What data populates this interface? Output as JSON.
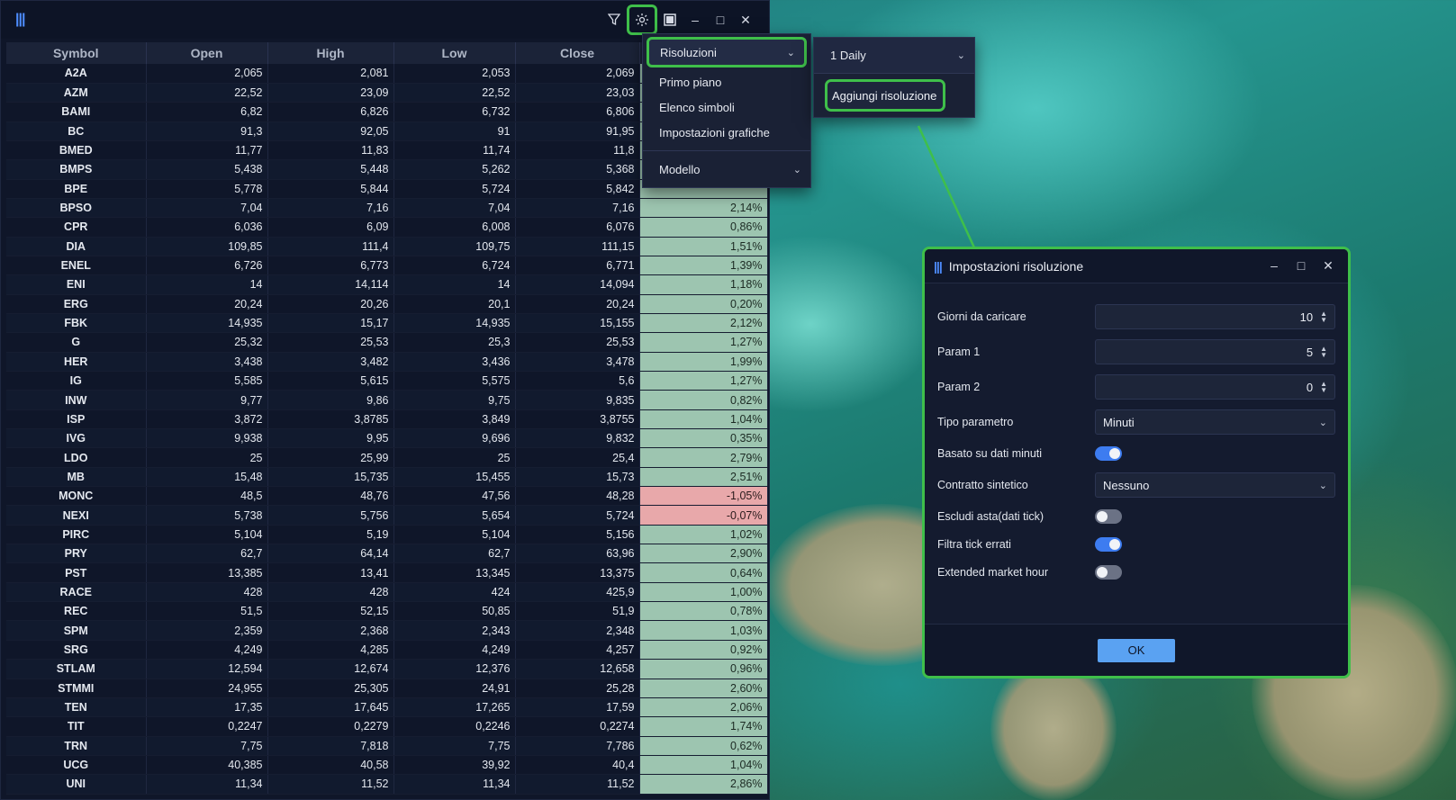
{
  "app": {
    "logo_glyph": "|||",
    "toolbar_icons": [
      "filter-icon",
      "gear-icon",
      "panel-icon",
      "minimize-icon",
      "maximize-icon",
      "close-icon"
    ]
  },
  "table": {
    "columns": [
      "Symbol",
      "Open",
      "High",
      "Low",
      "Close",
      ""
    ],
    "rows": [
      {
        "symbol": "A2A",
        "open": "2,065",
        "high": "2,081",
        "low": "2,053",
        "close": "2,069",
        "change": ""
      },
      {
        "symbol": "AZM",
        "open": "22,52",
        "high": "23,09",
        "low": "22,52",
        "close": "23,03",
        "change": ""
      },
      {
        "symbol": "BAMI",
        "open": "6,82",
        "high": "6,826",
        "low": "6,732",
        "close": "6,806",
        "change": ""
      },
      {
        "symbol": "BC",
        "open": "91,3",
        "high": "92,05",
        "low": "91",
        "close": "91,95",
        "change": ""
      },
      {
        "symbol": "BMED",
        "open": "11,77",
        "high": "11,83",
        "low": "11,74",
        "close": "11,8",
        "change": ""
      },
      {
        "symbol": "BMPS",
        "open": "5,438",
        "high": "5,448",
        "low": "5,262",
        "close": "5,368",
        "change": ""
      },
      {
        "symbol": "BPE",
        "open": "5,778",
        "high": "5,844",
        "low": "5,724",
        "close": "5,842",
        "change": ""
      },
      {
        "symbol": "BPSO",
        "open": "7,04",
        "high": "7,16",
        "low": "7,04",
        "close": "7,16",
        "change": "2,14%"
      },
      {
        "symbol": "CPR",
        "open": "6,036",
        "high": "6,09",
        "low": "6,008",
        "close": "6,076",
        "change": "0,86%"
      },
      {
        "symbol": "DIA",
        "open": "109,85",
        "high": "111,4",
        "low": "109,75",
        "close": "111,15",
        "change": "1,51%"
      },
      {
        "symbol": "ENEL",
        "open": "6,726",
        "high": "6,773",
        "low": "6,724",
        "close": "6,771",
        "change": "1,39%"
      },
      {
        "symbol": "ENI",
        "open": "14",
        "high": "14,114",
        "low": "14",
        "close": "14,094",
        "change": "1,18%"
      },
      {
        "symbol": "ERG",
        "open": "20,24",
        "high": "20,26",
        "low": "20,1",
        "close": "20,24",
        "change": "0,20%"
      },
      {
        "symbol": "FBK",
        "open": "14,935",
        "high": "15,17",
        "low": "14,935",
        "close": "15,155",
        "change": "2,12%"
      },
      {
        "symbol": "G",
        "open": "25,32",
        "high": "25,53",
        "low": "25,3",
        "close": "25,53",
        "change": "1,27%"
      },
      {
        "symbol": "HER",
        "open": "3,438",
        "high": "3,482",
        "low": "3,436",
        "close": "3,478",
        "change": "1,99%"
      },
      {
        "symbol": "IG",
        "open": "5,585",
        "high": "5,615",
        "low": "5,575",
        "close": "5,6",
        "change": "1,27%"
      },
      {
        "symbol": "INW",
        "open": "9,77",
        "high": "9,86",
        "low": "9,75",
        "close": "9,835",
        "change": "0,82%"
      },
      {
        "symbol": "ISP",
        "open": "3,872",
        "high": "3,8785",
        "low": "3,849",
        "close": "3,8755",
        "change": "1,04%"
      },
      {
        "symbol": "IVG",
        "open": "9,938",
        "high": "9,95",
        "low": "9,696",
        "close": "9,832",
        "change": "0,35%"
      },
      {
        "symbol": "LDO",
        "open": "25",
        "high": "25,99",
        "low": "25",
        "close": "25,4",
        "change": "2,79%"
      },
      {
        "symbol": "MB",
        "open": "15,48",
        "high": "15,735",
        "low": "15,455",
        "close": "15,73",
        "change": "2,51%"
      },
      {
        "symbol": "MONC",
        "open": "48,5",
        "high": "48,76",
        "low": "47,56",
        "close": "48,28",
        "change": "-1,05%"
      },
      {
        "symbol": "NEXI",
        "open": "5,738",
        "high": "5,756",
        "low": "5,654",
        "close": "5,724",
        "change": "-0,07%"
      },
      {
        "symbol": "PIRC",
        "open": "5,104",
        "high": "5,19",
        "low": "5,104",
        "close": "5,156",
        "change": "1,02%"
      },
      {
        "symbol": "PRY",
        "open": "62,7",
        "high": "64,14",
        "low": "62,7",
        "close": "63,96",
        "change": "2,90%"
      },
      {
        "symbol": "PST",
        "open": "13,385",
        "high": "13,41",
        "low": "13,345",
        "close": "13,375",
        "change": "0,64%"
      },
      {
        "symbol": "RACE",
        "open": "428",
        "high": "428",
        "low": "424",
        "close": "425,9",
        "change": "1,00%"
      },
      {
        "symbol": "REC",
        "open": "51,5",
        "high": "52,15",
        "low": "50,85",
        "close": "51,9",
        "change": "0,78%"
      },
      {
        "symbol": "SPM",
        "open": "2,359",
        "high": "2,368",
        "low": "2,343",
        "close": "2,348",
        "change": "1,03%"
      },
      {
        "symbol": "SRG",
        "open": "4,249",
        "high": "4,285",
        "low": "4,249",
        "close": "4,257",
        "change": "0,92%"
      },
      {
        "symbol": "STLAM",
        "open": "12,594",
        "high": "12,674",
        "low": "12,376",
        "close": "12,658",
        "change": "0,96%"
      },
      {
        "symbol": "STMMI",
        "open": "24,955",
        "high": "25,305",
        "low": "24,91",
        "close": "25,28",
        "change": "2,60%"
      },
      {
        "symbol": "TEN",
        "open": "17,35",
        "high": "17,645",
        "low": "17,265",
        "close": "17,59",
        "change": "2,06%"
      },
      {
        "symbol": "TIT",
        "open": "0,2247",
        "high": "0,2279",
        "low": "0,2246",
        "close": "0,2274",
        "change": "1,74%"
      },
      {
        "symbol": "TRN",
        "open": "7,75",
        "high": "7,818",
        "low": "7,75",
        "close": "7,786",
        "change": "0,62%"
      },
      {
        "symbol": "UCG",
        "open": "40,385",
        "high": "40,58",
        "low": "39,92",
        "close": "40,4",
        "change": "1,04%"
      },
      {
        "symbol": "UNI",
        "open": "11,34",
        "high": "11,52",
        "low": "11,34",
        "close": "11,52",
        "change": "2,86%"
      }
    ]
  },
  "menu": {
    "items": [
      "Risoluzioni",
      "Primo piano",
      "Elenco simboli",
      "Impostazioni grafiche"
    ],
    "model_label": "Modello"
  },
  "submenu": {
    "selected": "1 Daily",
    "add_label": "Aggiungi risoluzione"
  },
  "dialog": {
    "title": "Impostazioni risoluzione",
    "fields": {
      "giorni_label": "Giorni da caricare",
      "giorni_value": "10",
      "param1_label": "Param 1",
      "param1_value": "5",
      "param2_label": "Param 2",
      "param2_value": "0",
      "tipo_label": "Tipo parametro",
      "tipo_value": "Minuti",
      "basato_label": "Basato su dati minuti",
      "basato_on": true,
      "contratto_label": "Contratto sintetico",
      "contratto_value": "Nessuno",
      "escludi_label": "Escludi asta(dati tick)",
      "escludi_on": false,
      "filtra_label": "Filtra tick errati",
      "filtra_on": true,
      "extended_label": "Extended market hour",
      "extended_on": false
    },
    "ok_label": "OK"
  },
  "colors": {
    "highlight": "#3fbf4a",
    "positive_cell": "#9dc5b0",
    "negative_cell": "#e8a8aa",
    "toggle_on": "#3d7cf0",
    "ok_button": "#5aa2f2"
  }
}
